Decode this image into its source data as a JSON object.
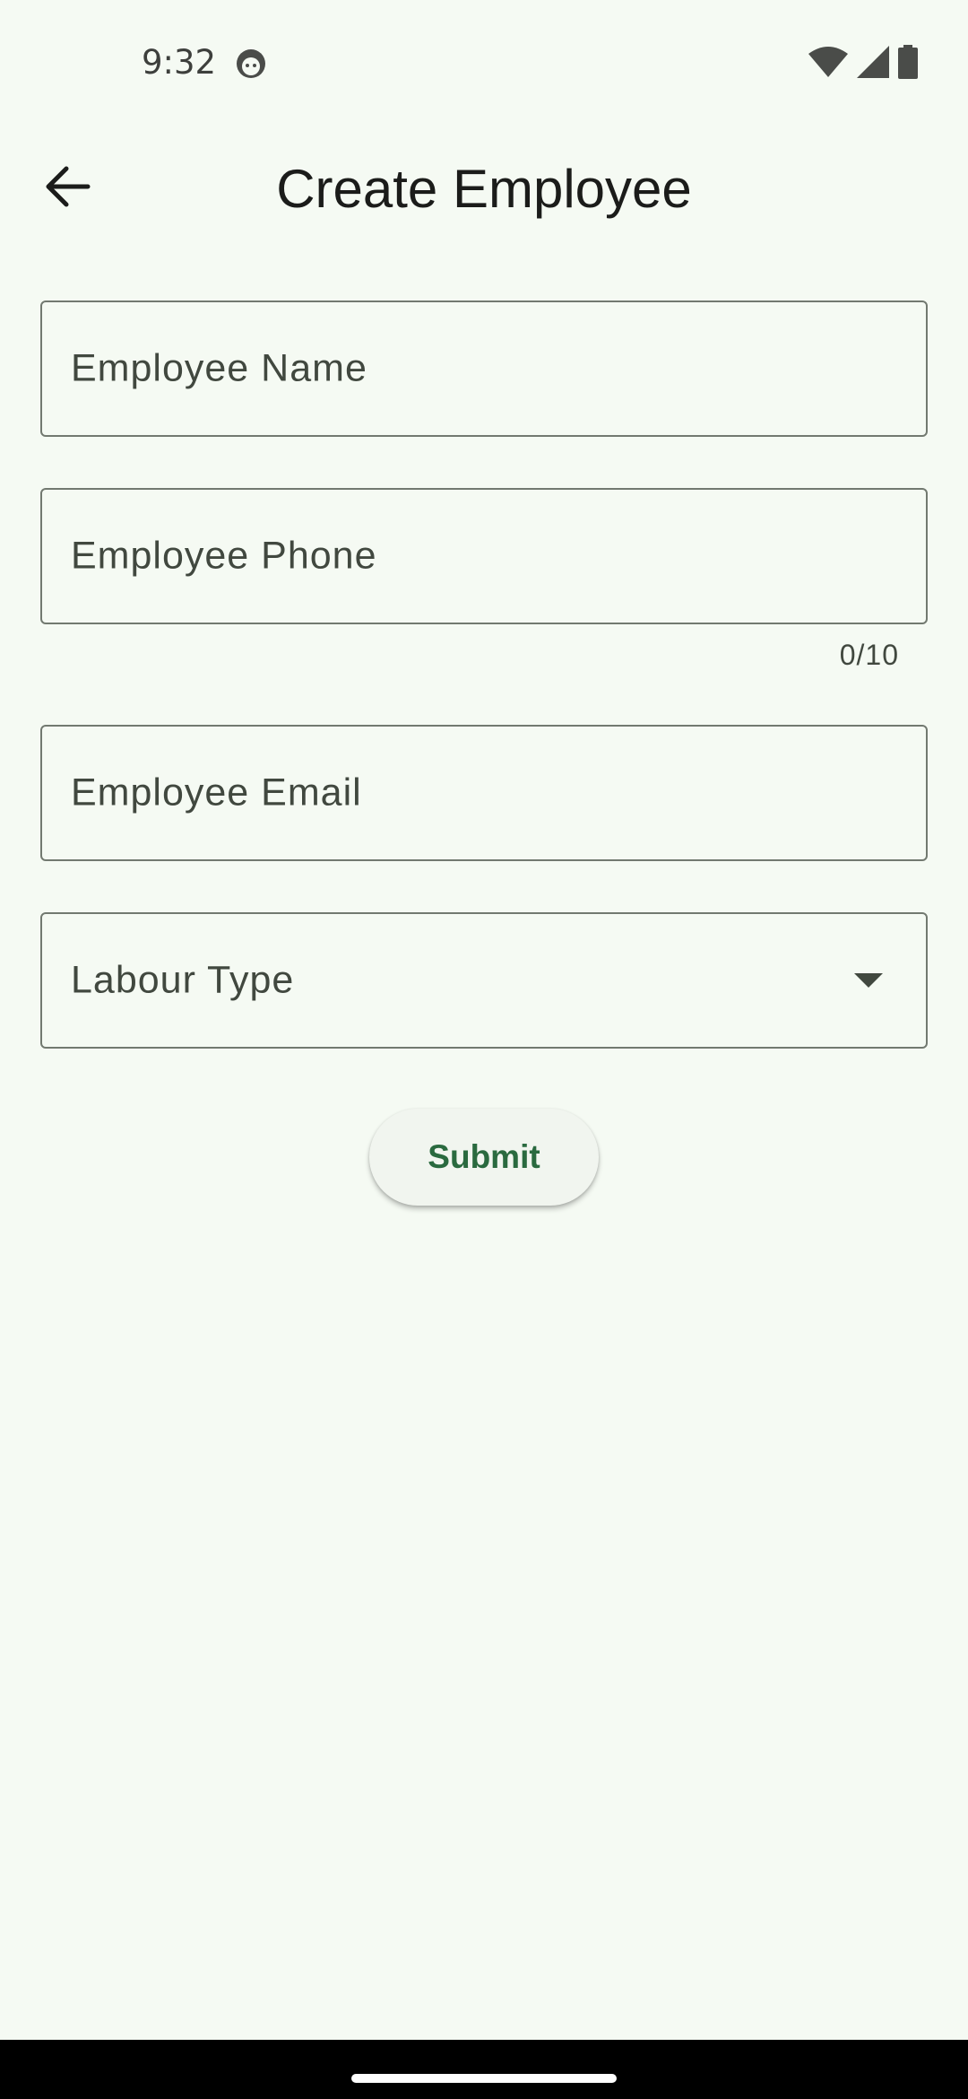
{
  "status_bar": {
    "time": "9:32",
    "icons": [
      "face-icon",
      "wifi-icon",
      "signal-icon",
      "battery-icon"
    ]
  },
  "app_bar": {
    "title": "Create Employee",
    "back_icon": "arrow-back-icon"
  },
  "form": {
    "employee_name": {
      "label": "Employee Name",
      "value": ""
    },
    "employee_phone": {
      "label": "Employee Phone",
      "value": "",
      "counter": "0/10"
    },
    "employee_email": {
      "label": "Employee Email",
      "value": ""
    },
    "labour_type": {
      "label": "Labour Type",
      "icon": "dropdown-arrow-icon"
    },
    "submit_label": "Submit"
  },
  "colors": {
    "background": "#f5faf3",
    "accent": "#2a6a3f",
    "outline": "#727970"
  }
}
